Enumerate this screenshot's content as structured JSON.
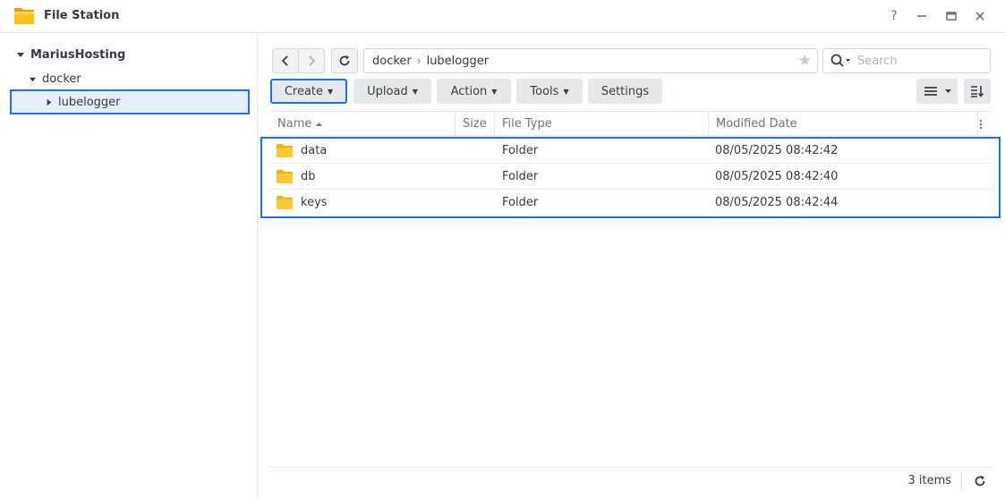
{
  "window": {
    "title": "File Station",
    "icon": "folder-app-icon",
    "controls": {
      "help": "?",
      "minimize": "–",
      "maximize": "□",
      "close": "✕"
    }
  },
  "sidebar": {
    "root": {
      "label": "MariusHosting",
      "expanded": true
    },
    "items": [
      {
        "label": "docker",
        "expanded": true
      },
      {
        "label": "lubelogger",
        "expanded": false,
        "selected": true
      }
    ]
  },
  "toolbar": {
    "path": [
      "docker",
      "lubelogger"
    ],
    "search_placeholder": "Search",
    "buttons": [
      "Create",
      "Upload",
      "Action",
      "Tools",
      "Settings"
    ],
    "active_button": "Create"
  },
  "table": {
    "columns": [
      "Name",
      "Size",
      "File Type",
      "Modified Date"
    ],
    "sort": "Name ascending",
    "rows": [
      {
        "name": "data",
        "size": "",
        "type": "Folder",
        "modified": "08/05/2025 08:42:42"
      },
      {
        "name": "db",
        "size": "",
        "type": "Folder",
        "modified": "08/05/2025 08:42:40"
      },
      {
        "name": "keys",
        "size": "",
        "type": "Folder",
        "modified": "08/05/2025 08:42:44"
      }
    ]
  },
  "footer": {
    "count": "3 items"
  },
  "colors": {
    "accent": "#1f70e6",
    "folder": "#f5b400",
    "selected_bg": "#e5effb"
  }
}
